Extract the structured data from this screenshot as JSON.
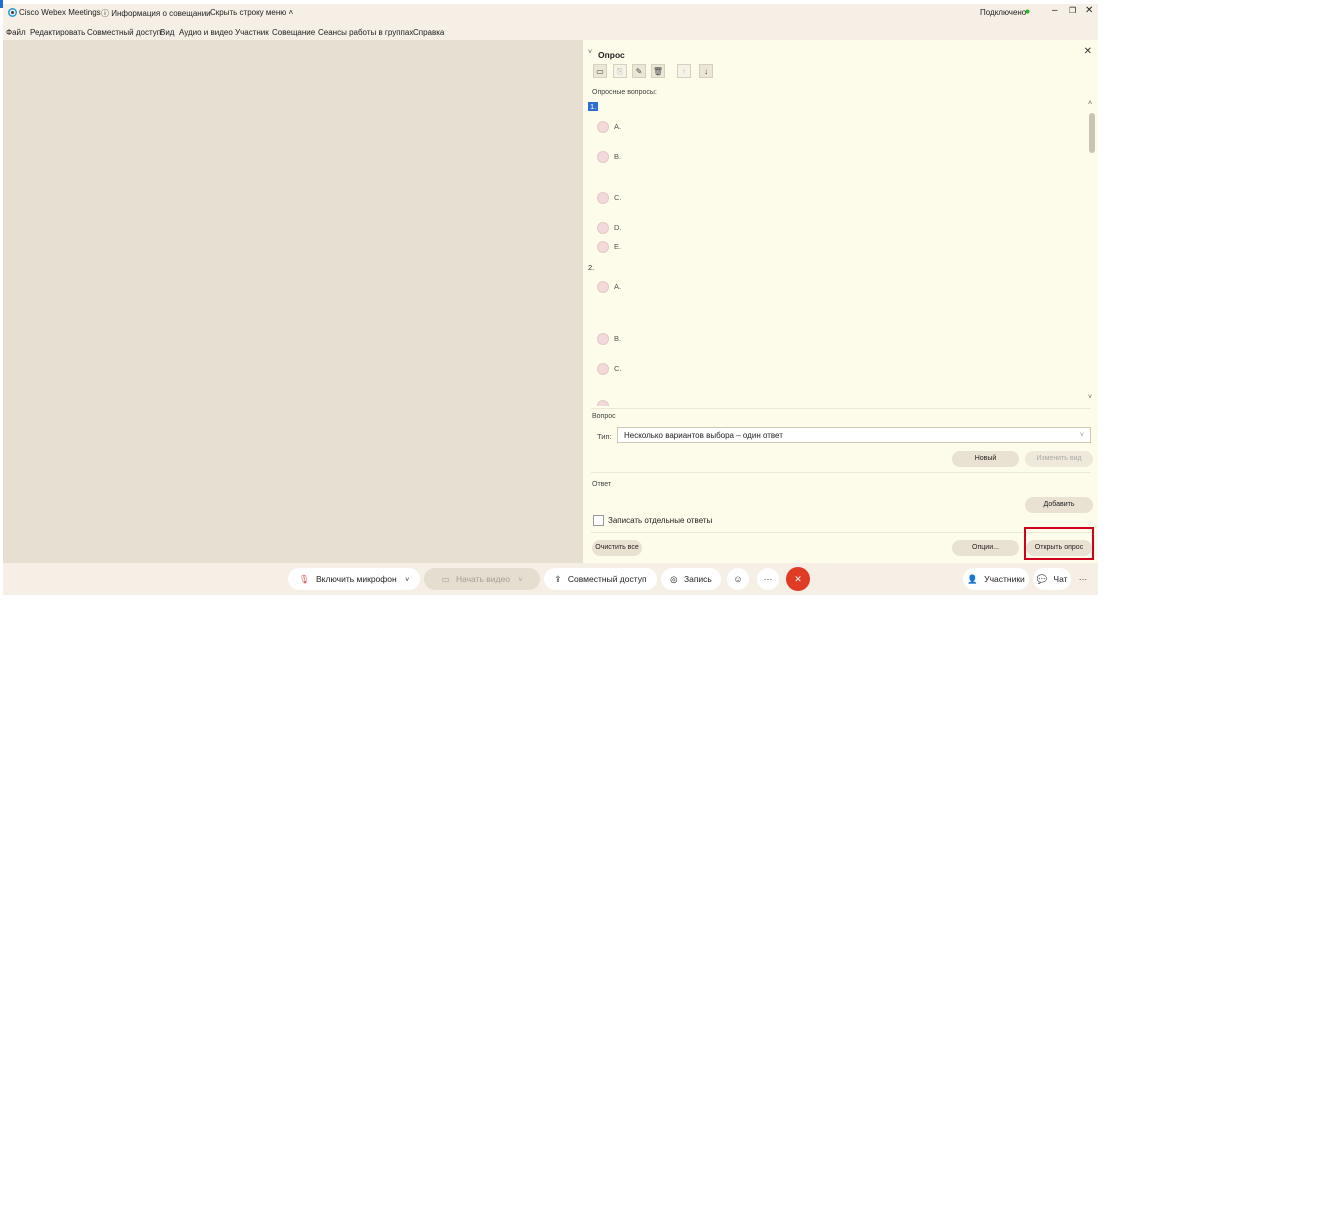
{
  "titlebar": {
    "app": "Cisco Webex Meetings",
    "meeting_info": "Информация о совещании",
    "hide_menu": "Скрыть строку меню",
    "status": "Подключено",
    "status_color": "#2eb82e"
  },
  "menu": [
    "Файл",
    "Редактировать",
    "Совместный доступ",
    "Вид",
    "Аудио и видео",
    "Участник",
    "Совещание",
    "Сеансы работы в группах",
    "Справка"
  ],
  "poll": {
    "title": "Опрос",
    "questions_label": "Опросные вопросы:",
    "questions": [
      {
        "num": "1.",
        "options": [
          "A.",
          "B.",
          "C.",
          "D.",
          "E."
        ]
      },
      {
        "num": "2.",
        "options": [
          "A.",
          "B.",
          "C."
        ]
      }
    ],
    "question_section": "Вопрос",
    "type_label": "Тип:",
    "type_value": "Несколько вариантов выбора – один ответ",
    "new_button": "Новый",
    "change_view_button": "Изменить вид",
    "answer_section": "Ответ",
    "add_button": "Добавить",
    "record_checkbox": "Записать отдельные ответы",
    "clear_all_button": "Очистить все",
    "options_button": "Опции...",
    "open_poll_button": "Открыть опрос"
  },
  "controls": {
    "mic": "Включить микрофон",
    "video": "Начать видео",
    "share": "Совместный доступ",
    "record": "Запись",
    "participants": "Участники",
    "chat": "Чат"
  },
  "colors": {
    "highlight": "#d0021b",
    "end_call": "#e03b24",
    "selection": "#2c6fd1"
  }
}
